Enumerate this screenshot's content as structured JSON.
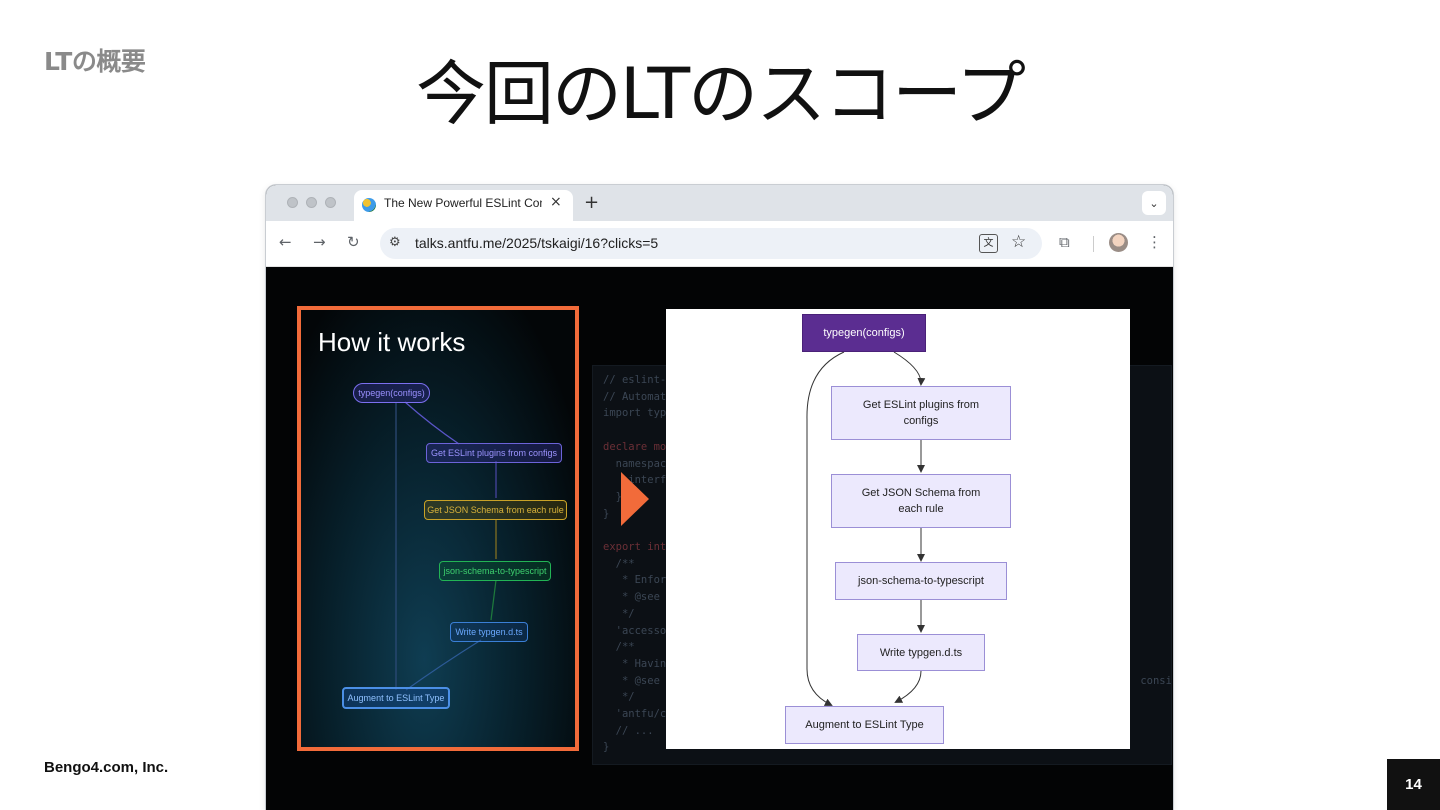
{
  "slide": {
    "section_label": "LTの概要",
    "title": "今回のLTのスコープ",
    "footer_company": "Bengo4.com, Inc.",
    "page_number": "14"
  },
  "browser": {
    "tab": {
      "title": "The New Powerful ESLint Config",
      "close_icon": "×",
      "favicon": "globe-favicon"
    },
    "new_tab_icon": "+",
    "tab_menu_icon": "⌄",
    "nav": {
      "back_icon": "←",
      "forward_icon": "→",
      "reload_icon": "↻"
    },
    "url": "talks.antfu.me/2025/tskaigi/16?clicks=5",
    "site_settings_icon": "⚙",
    "translate_icon": "文",
    "bookmark_icon": "☆",
    "extensions_icon": "⧉",
    "menu_icon": "⋮"
  },
  "code_lines": [
    "// eslint-typegen",
    "// Automatically generated",
    "import type { Linter } from 'eslint'",
    "",
    "declare module 'eslint' {",
    "  namespace Linter {",
    "    interface RulesRecord extends RuleOptions {}",
    "  }",
    "}",
    "",
    "export interface RuleOptions {",
    "  /**",
    "   * Enforce getter and setter pairs",
    "   * @see https://eslint.org/docs/latest/rules",
    "   */",
    "  'accessor-pairs'?: Linter.RuleEntry<AccessorPairs>",
    "  /**",
    "   * Having line breaks styles to object, array",
    "   * @see https://github.com/antfu/eslint-plugin-antfu                               consistent-",
    "   */",
    "  'antfu/consistent-list-newline'?: Linter.RuleEntry",
    "  // ...",
    "}"
  ],
  "slide_panel": {
    "title": "How it works",
    "nodes": [
      {
        "label": "typegen(configs)",
        "color": "#7b6ff0"
      },
      {
        "label": "Get ESLint plugins from configs",
        "color": "#6c63d9"
      },
      {
        "label": "Get JSON Schema from each rule",
        "color": "#c9a227"
      },
      {
        "label": "json-schema-to-typescript",
        "color": "#22b455"
      },
      {
        "label": "Write typgen.d.ts",
        "color": "#3a7fd6"
      },
      {
        "label": "Augment to ESLint Type",
        "color": "#4b8fe6"
      }
    ]
  },
  "flowchart": {
    "nodes": [
      {
        "label": "typegen(configs)"
      },
      {
        "label": "Get ESLint plugins from configs"
      },
      {
        "label": "Get JSON Schema from each rule"
      },
      {
        "label": "json-schema-to-typescript"
      },
      {
        "label": "Write typgen.d.ts"
      },
      {
        "label": "Augment to ESLint Type"
      }
    ]
  },
  "colors": {
    "accent": "#f26b3a",
    "flow_top_node": "#5b2d91",
    "flow_node_fill": "#ece9fd",
    "flow_node_border": "#9b8fd6"
  }
}
